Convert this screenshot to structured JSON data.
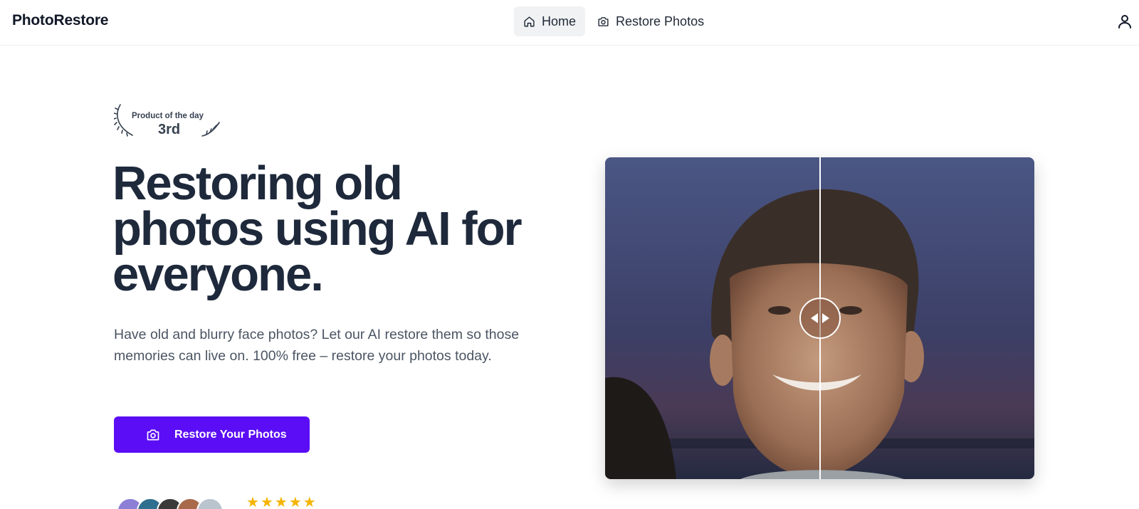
{
  "brand": "PhotoRestore",
  "nav": {
    "home": "Home",
    "restore": "Restore Photos"
  },
  "award": {
    "label": "Product of the day",
    "rank": "3rd"
  },
  "hero": {
    "title": "Restoring old photos using AI for everyone.",
    "subtitle": "Have old and blurry face photos? Let our AI restore them so those memories can live on. 100% free – restore your photos today.",
    "cta": "Restore Your Photos"
  },
  "rating": {
    "stars": 5
  },
  "colors": {
    "accent": "#5b0ef5",
    "star": "#f5b400",
    "title": "#1e293b"
  }
}
